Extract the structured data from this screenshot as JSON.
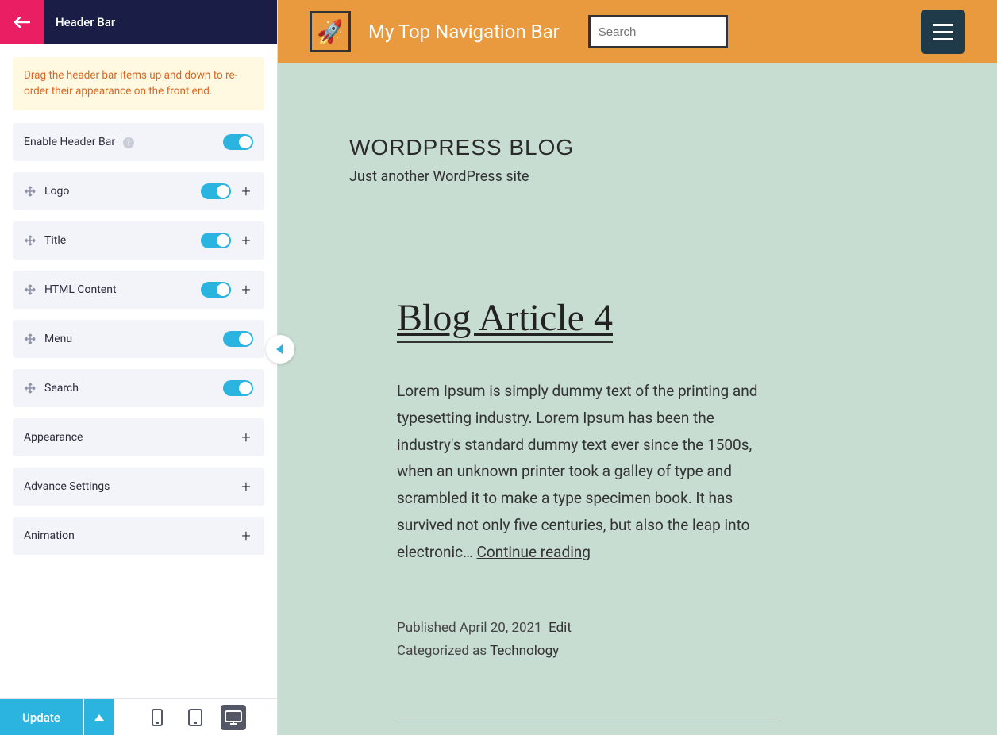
{
  "sidebar": {
    "title": "Header Bar",
    "notice": "Drag the header bar items up and down to re-order their appearance on the front end.",
    "enable_label": "Enable Header Bar",
    "items": [
      {
        "label": "Logo",
        "expandable": true
      },
      {
        "label": "Title",
        "expandable": true
      },
      {
        "label": "HTML Content",
        "expandable": true
      },
      {
        "label": "Menu",
        "expandable": false
      },
      {
        "label": "Search",
        "expandable": false
      }
    ],
    "sections": [
      {
        "label": "Appearance"
      },
      {
        "label": "Advance Settings"
      },
      {
        "label": "Animation"
      }
    ],
    "update_label": "Update"
  },
  "preview": {
    "nav_title": "My Top Navigation Bar",
    "search_placeholder": "Search",
    "site_title": "WORDPRESS BLOG",
    "site_tagline": "Just another WordPress site",
    "post_title": "Blog Article 4",
    "post_body": "Lorem Ipsum is simply dummy text of the printing and typesetting industry. Lorem Ipsum has been the industry's standard dummy text ever since the 1500s, when an unknown printer took a galley of type and scrambled it to make a type specimen book. It has survived not only five centuries, but also the leap into electronic… ",
    "continue_label": "Continue reading",
    "published_prefix": "Published ",
    "published_date": "April 20, 2021",
    "edit_label": "Edit",
    "categorized_prefix": "Categorized as ",
    "category": "Technology"
  }
}
